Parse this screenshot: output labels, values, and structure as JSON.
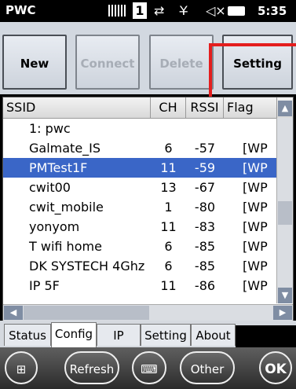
{
  "status_bar": {
    "app_title": "PWC",
    "icons": [
      "battery-level-icon",
      "notification-one-icon",
      "sync-icon",
      "no-signal-icon",
      "volume-muted-icon",
      "battery-icon"
    ],
    "notification_count": "1",
    "time": "5:35"
  },
  "toolbar": {
    "new_label": "New",
    "connect_label": "Connect",
    "delete_label": "Delete",
    "setting_label": "Setting"
  },
  "list": {
    "columns": [
      "SSID",
      "CH",
      "RSSI",
      "Flag"
    ],
    "rows": [
      {
        "ssid": "1: pwc",
        "ch": "",
        "rssi": "",
        "flag": ""
      },
      {
        "ssid": "Galmate_IS",
        "ch": "6",
        "rssi": "-57",
        "flag": "[WP"
      },
      {
        "ssid": "PMTest1F",
        "ch": "11",
        "rssi": "-59",
        "flag": "[WP"
      },
      {
        "ssid": "cwit00",
        "ch": "13",
        "rssi": "-67",
        "flag": "[WP"
      },
      {
        "ssid": "cwit_mobile",
        "ch": "1",
        "rssi": "-80",
        "flag": "[WP"
      },
      {
        "ssid": "yonyom",
        "ch": "11",
        "rssi": "-83",
        "flag": "[WP"
      },
      {
        "ssid": "T wifi home",
        "ch": "6",
        "rssi": "-85",
        "flag": "[WP"
      },
      {
        "ssid": "DK SYSTECH 4Ghz",
        "ch": "6",
        "rssi": "-85",
        "flag": "[WP"
      },
      {
        "ssid": "IP 5F",
        "ch": "11",
        "rssi": "-86",
        "flag": "[WP"
      }
    ],
    "selected_index": 2,
    "selection_color": "#3a66c7"
  },
  "tabs": [
    "Status",
    "Config",
    "IP",
    "Setting",
    "About"
  ],
  "active_tab": "Config",
  "softkeys": {
    "refresh_label": "Refresh",
    "other_label": "Other",
    "ok_label": "OK"
  },
  "accent_color": "#e41e1e"
}
